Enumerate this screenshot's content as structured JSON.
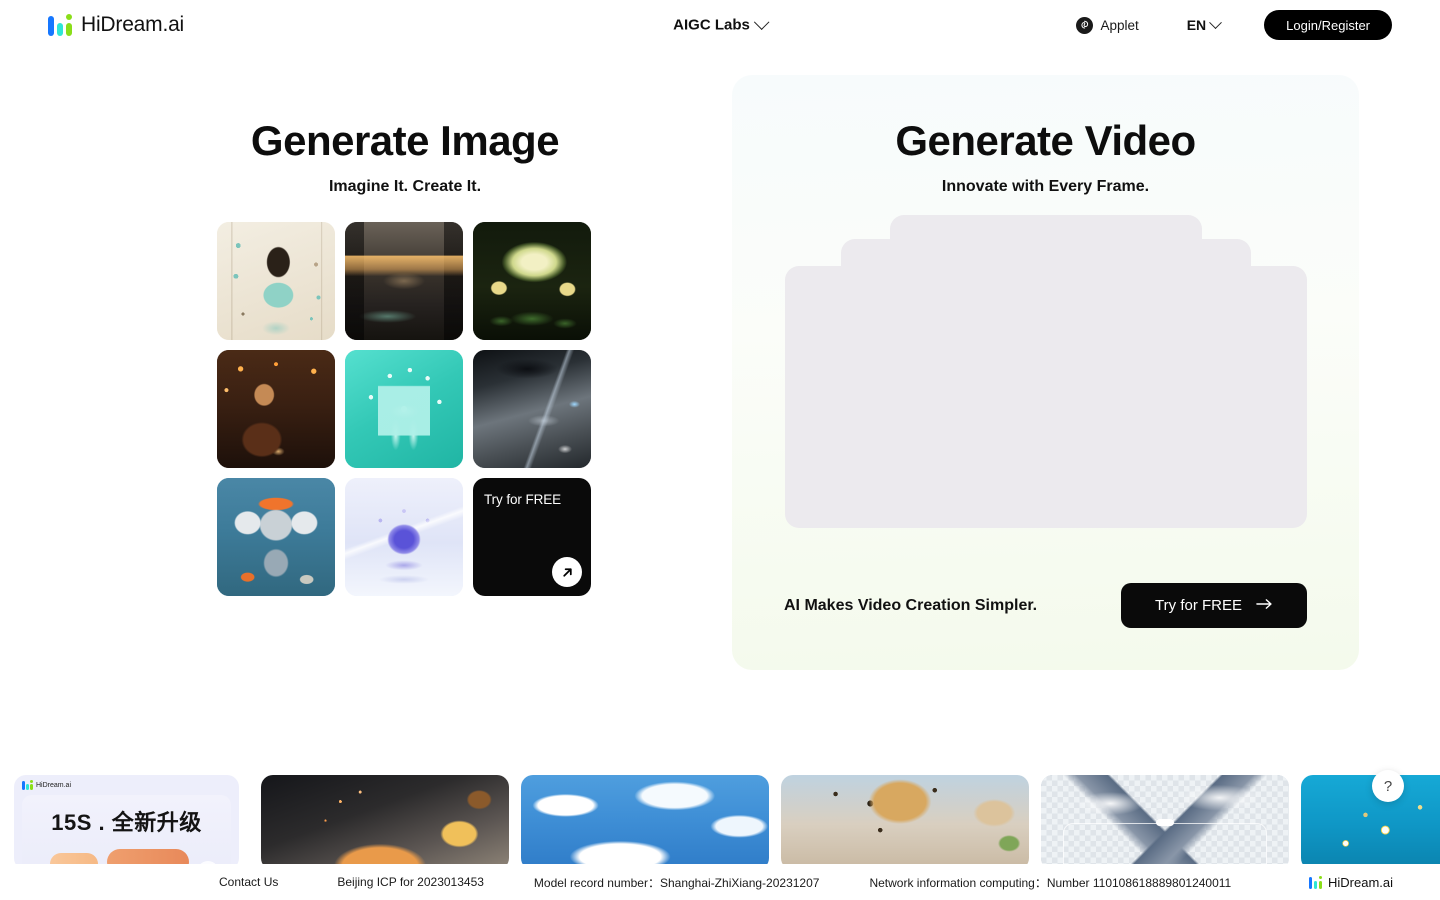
{
  "header": {
    "brand_name": "HiDream.ai",
    "nav_center_label": "AIGC Labs",
    "applet_label": "Applet",
    "language_label": "EN",
    "login_label": "Login/Register"
  },
  "image_panel": {
    "title": "Generate Image",
    "subtitle": "Imagine It. Create It.",
    "cta_label": "Try for FREE",
    "tiles": [
      {
        "name": "vintage-jewelry-illustration"
      },
      {
        "name": "modern-villa-at-dusk"
      },
      {
        "name": "glowing-lotus-flower"
      },
      {
        "name": "man-in-tavern-portrait"
      },
      {
        "name": "teal-gift-box-with-bow"
      },
      {
        "name": "futuristic-spaceship-interior"
      },
      {
        "name": "cartoon-elephant-mechanic"
      },
      {
        "name": "crystal-crown"
      }
    ]
  },
  "video_panel": {
    "title": "Generate Video",
    "subtitle": "Innovate with Every Frame.",
    "footer_text": "AI Makes Video Creation Simpler.",
    "cta_label": "Try for FREE"
  },
  "carousel": {
    "promo_card": {
      "logo_text": "HiDream.ai",
      "title": "15S . 全新升级"
    },
    "cards": [
      {
        "name": "bread-splash-artwork"
      },
      {
        "name": "blue-sky-clouds-artwork"
      },
      {
        "name": "leopard-portrait-artwork"
      },
      {
        "name": "mountain-landscape-artwork"
      },
      {
        "name": "daisies-blue-water-artwork"
      },
      {
        "name": "partial-artwork"
      }
    ]
  },
  "help": {
    "label": "?"
  },
  "footer": {
    "contact": "Contact Us",
    "icp": "Beijing ICP for 2023013453",
    "model_record": "Model record number：Shanghai-ZhiXiang-20231207",
    "network_info": "Network information computing：Number 110108618889801240011",
    "brand_name": "HiDream.ai"
  },
  "colors": {
    "accent_blue": "#1677ff",
    "accent_cyan": "#2ee6d6",
    "accent_green": "#8ade19",
    "cta_black": "#0a0a0a"
  }
}
